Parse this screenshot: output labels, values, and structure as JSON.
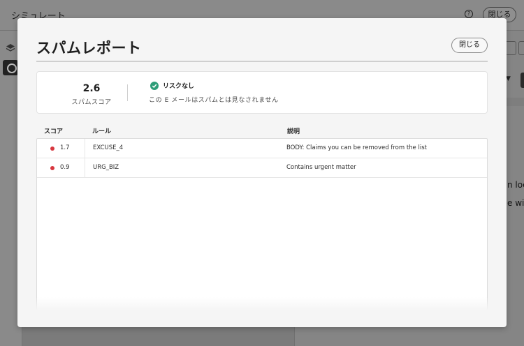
{
  "background": {
    "app_title": "シミュレート",
    "help_icon": "?",
    "close_label": "閉じる",
    "partial_text_1": "n loca",
    "partial_text_2": "e will"
  },
  "modal": {
    "title": "スパムレポート",
    "close_label": "閉じる",
    "score": {
      "value": "2.6",
      "label": "スパムスコア"
    },
    "risk": {
      "icon": "check-circle-icon",
      "label": "リスクなし",
      "description": "この E メールはスパムとは見なされません"
    },
    "table": {
      "headers": [
        "スコア",
        "ルール",
        "説明"
      ],
      "rows": [
        {
          "score": "1.7",
          "rule": "EXCUSE_4",
          "description": "BODY: Claims you can be removed from the list"
        },
        {
          "score": "0.9",
          "rule": "URG_BIZ",
          "description": "Contains urgent matter"
        }
      ]
    }
  },
  "colors": {
    "accent_green": "#2d9d78",
    "bullet_red": "#d7373f",
    "overlay": "#7b7b7b"
  }
}
